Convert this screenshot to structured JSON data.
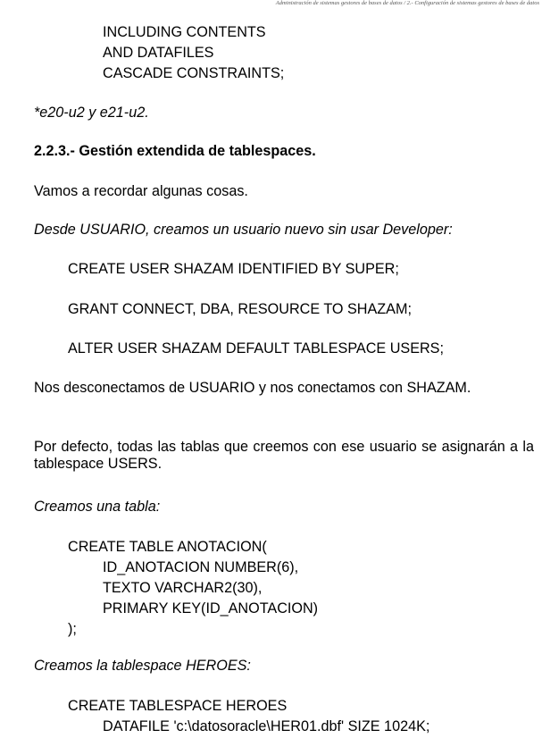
{
  "header": "Administración de sistemas gestores de bases de datos / 2.- Configuración de sistemas gestores de bases de datos",
  "code_top": [
    "INCLUDING CONTENTS",
    "AND DATAFILES",
    "CASCADE CONSTRAINTS;"
  ],
  "note": "*e20-u2 y e21-u2.",
  "section_title": "2.2.3.- Gestión extendida de tablespaces.",
  "intro": "Vamos a recordar algunas cosas.",
  "from_user": "Desde USUARIO, creamos un usuario nuevo sin usar Developer:",
  "sql_create_user": "CREATE USER SHAZAM IDENTIFIED BY SUPER;",
  "sql_grant": "GRANT CONNECT, DBA, RESOURCE TO SHAZAM;",
  "sql_alter_user": "ALTER USER SHAZAM DEFAULT TABLESPACE USERS;",
  "para_disconnect": "Nos desconectamos de USUARIO y nos conectamos con SHAZAM.",
  "para_default": "Por defecto, todas las tablas que creemos con ese usuario se asignarán a la tablespace USERS.",
  "create_table_label": "Creamos una tabla:",
  "create_table_code": [
    "CREATE TABLE ANOTACION(",
    "ID_ANOTACION NUMBER(6),",
    "TEXTO VARCHAR2(30),",
    "PRIMARY KEY(ID_ANOTACION)",
    ");"
  ],
  "create_tablespace_label": "Creamos la tablespace HEROES:",
  "create_tablespace_code": [
    "CREATE TABLESPACE HEROES",
    "DATAFILE 'c:\\datosoracle\\HER01.dbf' SIZE 1024K;"
  ]
}
